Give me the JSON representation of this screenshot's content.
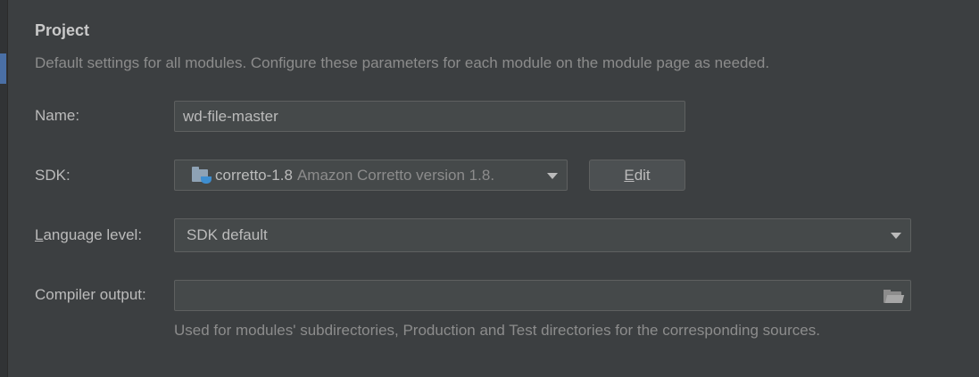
{
  "section": {
    "title": "Project",
    "description": "Default settings for all modules. Configure these parameters for each module on the module page as needed."
  },
  "name": {
    "label": "Name:",
    "value": "wd-file-master"
  },
  "sdk": {
    "label": "SDK:",
    "value": "corretto-1.8",
    "version": "Amazon Corretto version 1.8.",
    "icon": "jdk-folder-icon",
    "edit_mnemonic": "E",
    "edit_rest": "dit"
  },
  "language_level": {
    "label_mnemonic": "L",
    "label_rest": "anguage level:",
    "value": "SDK default"
  },
  "compiler_output": {
    "label": "Compiler output:",
    "value": "",
    "hint": "Used for modules' subdirectories, Production and Test directories for the corresponding sources."
  },
  "colors": {
    "background": "#3c3f41",
    "field_background": "#45494a",
    "selection_accent": "#4a6fa5"
  }
}
